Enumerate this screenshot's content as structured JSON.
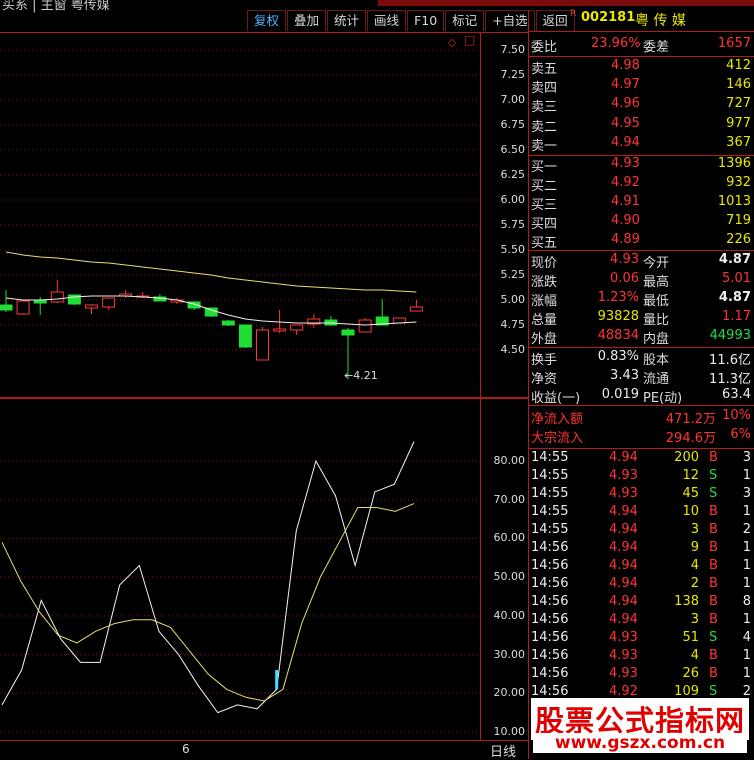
{
  "window": {
    "title": "买系 | 主窗 粤传媒"
  },
  "toolbar": [
    {
      "label": "复权",
      "active": true
    },
    {
      "label": "叠加"
    },
    {
      "label": "统计"
    },
    {
      "label": "画线"
    },
    {
      "label": "F10"
    },
    {
      "label": "标记"
    },
    {
      "label": "+自选"
    },
    {
      "label": "返回"
    }
  ],
  "stock": {
    "r_badge": "R",
    "code": "002181",
    "name": "粤 传 媒"
  },
  "main_axis": {
    "ticks": [
      "7.50",
      "7.25",
      "7.00",
      "6.75",
      "6.50",
      "6.25",
      "6.00",
      "5.75",
      "5.50",
      "5.25",
      "5.00",
      "4.75",
      "4.50"
    ]
  },
  "sub_axis": {
    "ticks": [
      "80.00",
      "70.00",
      "60.00",
      "50.00",
      "40.00",
      "30.00",
      "20.00",
      "10.00"
    ]
  },
  "chart_bottom": {
    "x_label": "6",
    "period": "日线"
  },
  "low_annotation": "←4.21",
  "chart_data": {
    "type": "candlestick",
    "price_axis": {
      "min": 4.5,
      "max": 7.5,
      "step": 0.25
    },
    "indicator_axis": {
      "min": 10,
      "max": 80,
      "step": 10
    },
    "candles": [
      {
        "o": 4.95,
        "h": 5.1,
        "l": 4.88,
        "c": 4.9
      },
      {
        "o": 4.86,
        "h": 5.0,
        "l": 4.85,
        "c": 4.99
      },
      {
        "o": 5.0,
        "h": 5.03,
        "l": 4.85,
        "c": 4.97
      },
      {
        "o": 4.98,
        "h": 5.2,
        "l": 4.97,
        "c": 5.08
      },
      {
        "o": 5.05,
        "h": 5.05,
        "l": 4.95,
        "c": 4.96
      },
      {
        "o": 4.92,
        "h": 4.96,
        "l": 4.86,
        "c": 4.95
      },
      {
        "o": 4.93,
        "h": 5.02,
        "l": 4.9,
        "c": 5.02
      },
      {
        "o": 5.04,
        "h": 5.1,
        "l": 5.02,
        "c": 5.06
      },
      {
        "o": 5.04,
        "h": 5.08,
        "l": 5.02,
        "c": 5.04
      },
      {
        "o": 5.03,
        "h": 5.06,
        "l": 4.99,
        "c": 4.99
      },
      {
        "o": 4.98,
        "h": 5.02,
        "l": 4.96,
        "c": 5.0
      },
      {
        "o": 4.98,
        "h": 4.99,
        "l": 4.9,
        "c": 4.92
      },
      {
        "o": 4.92,
        "h": 4.92,
        "l": 4.83,
        "c": 4.84
      },
      {
        "o": 4.79,
        "h": 4.8,
        "l": 4.74,
        "c": 4.75
      },
      {
        "o": 4.75,
        "h": 4.75,
        "l": 4.52,
        "c": 4.53
      },
      {
        "o": 4.4,
        "h": 4.73,
        "l": 4.4,
        "c": 4.7
      },
      {
        "o": 4.69,
        "h": 4.9,
        "l": 4.67,
        "c": 4.71
      },
      {
        "o": 4.7,
        "h": 4.75,
        "l": 4.65,
        "c": 4.75
      },
      {
        "o": 4.76,
        "h": 4.86,
        "l": 4.72,
        "c": 4.81
      },
      {
        "o": 4.8,
        "h": 4.84,
        "l": 4.74,
        "c": 4.75
      },
      {
        "o": 4.7,
        "h": 4.72,
        "l": 4.21,
        "c": 4.65
      },
      {
        "o": 4.68,
        "h": 4.82,
        "l": 4.68,
        "c": 4.8
      },
      {
        "o": 4.83,
        "h": 5.01,
        "l": 4.8,
        "c": 4.75
      },
      {
        "o": 4.77,
        "h": 4.82,
        "l": 4.77,
        "c": 4.82
      },
      {
        "o": 4.89,
        "h": 5.0,
        "l": 4.89,
        "c": 4.93
      }
    ],
    "ma_long": [
      5.48,
      5.45,
      5.43,
      5.42,
      5.4,
      5.38,
      5.37,
      5.35,
      5.33,
      5.31,
      5.29,
      5.27,
      5.25,
      5.22,
      5.2,
      5.18,
      5.16,
      5.14,
      5.13,
      5.12,
      5.11,
      5.1,
      5.1,
      5.09,
      5.08
    ],
    "ma_short": [
      5.02,
      5.0,
      5.0,
      5.01,
      5.03,
      5.04,
      5.04,
      5.04,
      5.03,
      5.02,
      5.0,
      4.96,
      4.9,
      4.85,
      4.81,
      4.79,
      4.78,
      4.77,
      4.77,
      4.77,
      4.76,
      4.75,
      4.76,
      4.77,
      4.78
    ],
    "kd_fast": [
      17,
      26,
      44,
      34,
      28,
      28,
      48,
      53,
      36,
      30,
      22,
      15,
      17,
      16,
      21,
      62,
      80,
      71,
      53,
      72,
      74,
      85
    ],
    "kd_slow": [
      59,
      49,
      41,
      35,
      33,
      36,
      38,
      39,
      39,
      37,
      31,
      25,
      21,
      19,
      18,
      21,
      38,
      50,
      59,
      68,
      68,
      67,
      69
    ],
    "kd_highlight_index": 14
  },
  "panel": {
    "weibi": {
      "label": "委比",
      "value": "23.96%"
    },
    "weicha": {
      "label": "委差",
      "value": "1657"
    },
    "asks": [
      {
        "label": "卖五",
        "price": "4.98",
        "vol": "412"
      },
      {
        "label": "卖四",
        "price": "4.97",
        "vol": "146"
      },
      {
        "label": "卖三",
        "price": "4.96",
        "vol": "727"
      },
      {
        "label": "卖二",
        "price": "4.95",
        "vol": "977"
      },
      {
        "label": "卖一",
        "price": "4.94",
        "vol": "367"
      }
    ],
    "bids": [
      {
        "label": "买一",
        "price": "4.93",
        "vol": "1396"
      },
      {
        "label": "买二",
        "price": "4.92",
        "vol": "932"
      },
      {
        "label": "买三",
        "price": "4.91",
        "vol": "1013"
      },
      {
        "label": "买四",
        "price": "4.90",
        "vol": "719"
      },
      {
        "label": "买五",
        "price": "4.89",
        "vol": "226"
      }
    ],
    "quote": [
      {
        "l1": "现价",
        "v1": "4.93",
        "c1": "red",
        "l2": "今开",
        "v2": "4.87",
        "c2": "wht"
      },
      {
        "l1": "涨跌",
        "v1": "0.06",
        "c1": "red",
        "l2": "最高",
        "v2": "5.01",
        "c2": "red"
      },
      {
        "l1": "涨幅",
        "v1": "1.23%",
        "c1": "red",
        "l2": "最低",
        "v2": "4.87",
        "c2": "wht"
      },
      {
        "l1": "总量",
        "v1": "93828",
        "c1": "yel",
        "l2": "量比",
        "v2": "1.17",
        "c2": "red"
      },
      {
        "l1": "外盘",
        "v1": "48834",
        "c1": "red",
        "l2": "内盘",
        "v2": "44993",
        "c2": "grn"
      }
    ],
    "fin": [
      {
        "l1": "换手",
        "v1": "0.83%",
        "l2": "股本",
        "v2": "11.6亿"
      },
      {
        "l1": "净资",
        "v1": "3.43",
        "l2": "流通",
        "v2": "11.3亿"
      },
      {
        "l1": "收益(一)",
        "v1": "0.019",
        "l2": "PE(动)",
        "v2": "63.4"
      }
    ],
    "flow": [
      {
        "label": "净流入额",
        "value": "471.2万",
        "pct": "10%"
      },
      {
        "label": "大宗流入",
        "value": "294.6万",
        "pct": "6%"
      }
    ],
    "ticks": [
      {
        "t": "14:55",
        "p": "4.94",
        "pc": "red",
        "v": "200",
        "d": "B",
        "n": "3"
      },
      {
        "t": "14:55",
        "p": "4.93",
        "pc": "red",
        "v": "12",
        "d": "S",
        "n": "1"
      },
      {
        "t": "14:55",
        "p": "4.93",
        "pc": "red",
        "v": "45",
        "d": "S",
        "n": "3"
      },
      {
        "t": "14:55",
        "p": "4.94",
        "pc": "red",
        "v": "10",
        "d": "B",
        "n": "1"
      },
      {
        "t": "14:55",
        "p": "4.94",
        "pc": "red",
        "v": "3",
        "d": "B",
        "n": "2"
      },
      {
        "t": "14:56",
        "p": "4.94",
        "pc": "red",
        "v": "9",
        "d": "B",
        "n": "1"
      },
      {
        "t": "14:56",
        "p": "4.94",
        "pc": "red",
        "v": "4",
        "d": "B",
        "n": "1"
      },
      {
        "t": "14:56",
        "p": "4.94",
        "pc": "red",
        "v": "2",
        "d": "B",
        "n": "1"
      },
      {
        "t": "14:56",
        "p": "4.94",
        "pc": "red",
        "v": "138",
        "d": "B",
        "n": "8"
      },
      {
        "t": "14:56",
        "p": "4.94",
        "pc": "red",
        "v": "3",
        "d": "B",
        "n": "1"
      },
      {
        "t": "14:56",
        "p": "4.93",
        "pc": "red",
        "v": "51",
        "d": "S",
        "n": "4"
      },
      {
        "t": "14:56",
        "p": "4.93",
        "pc": "red",
        "v": "4",
        "d": "B",
        "n": "1"
      },
      {
        "t": "14:56",
        "p": "4.93",
        "pc": "red",
        "v": "26",
        "d": "B",
        "n": "1"
      },
      {
        "t": "14:56",
        "p": "4.92",
        "pc": "red",
        "v": "109",
        "d": "S",
        "n": "2"
      }
    ]
  },
  "watermark": {
    "line1": "股票公式指标网",
    "line2": "www.gszx.com.cn"
  }
}
